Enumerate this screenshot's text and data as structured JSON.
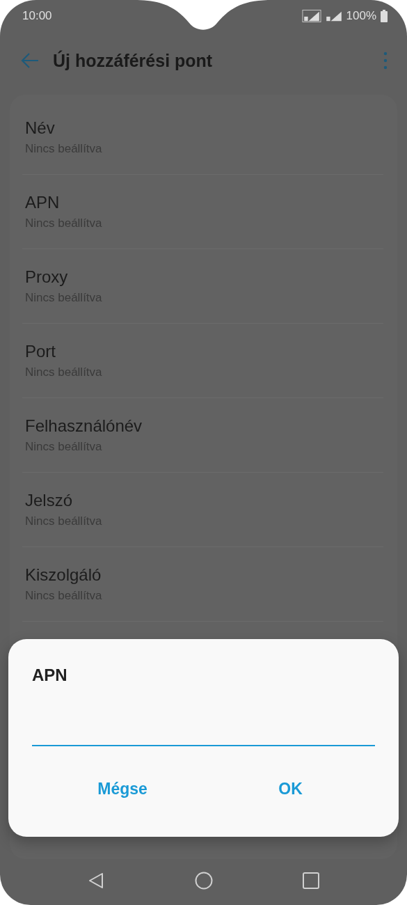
{
  "status_bar": {
    "time": "10:00",
    "battery": "100%"
  },
  "app_bar": {
    "title": "Új hozzáférési pont"
  },
  "settings": [
    {
      "title": "Név",
      "summary": "Nincs beállítva"
    },
    {
      "title": "APN",
      "summary": "Nincs beállítva"
    },
    {
      "title": "Proxy",
      "summary": "Nincs beállítva"
    },
    {
      "title": "Port",
      "summary": "Nincs beállítva"
    },
    {
      "title": "Felhasználónév",
      "summary": "Nincs beállítva"
    },
    {
      "title": "Jelszó",
      "summary": "Nincs beállítva"
    },
    {
      "title": "Kiszolgáló",
      "summary": "Nincs beállítva"
    }
  ],
  "dialog": {
    "title": "APN",
    "buttons": [
      {
        "label": "Mégse"
      },
      {
        "label": "OK"
      }
    ]
  }
}
